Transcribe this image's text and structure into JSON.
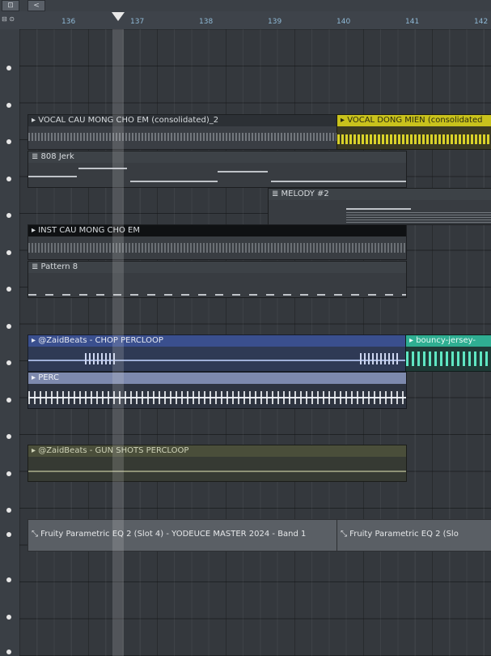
{
  "toolbar": {
    "btn1": "⊡",
    "btn2": "<"
  },
  "ruler": {
    "ticks": [
      "136",
      "137",
      "138",
      "139",
      "140",
      "141",
      "142"
    ],
    "left_icons": "⊟ ⊙"
  },
  "clips": {
    "vocal_cau": "▸ VOCAL CAU MONG CHO EM (consolidated)_2",
    "vocal_dong": "▸ VOCAL DONG MIEN (consolidated",
    "jerk808": "≣ 808 Jerk",
    "melody": "≣ MELODY #2",
    "inst": "▸ INST CAU MONG CHO EM",
    "pattern8": "≣ Pattern 8",
    "chop": "▸ @ZaidBeats - CHOP PERCLOOP",
    "bouncy": "▸ bouncy-jersey-",
    "perc": "▸ PERC",
    "gunshots": "▸ @ZaidBeats - GUN SHOTS PERCLOOP",
    "eq1": "⤡ Fruity Parametric EQ 2 (Slot 4) - YODEUCE MASTER 2024 - Band 1",
    "eq2": "⤡ Fruity Parametric EQ 2 (Slo"
  },
  "colors": {
    "accent_yellow": "#c9c21c",
    "accent_blue": "#3a4f8e",
    "accent_teal": "#2fae92"
  }
}
